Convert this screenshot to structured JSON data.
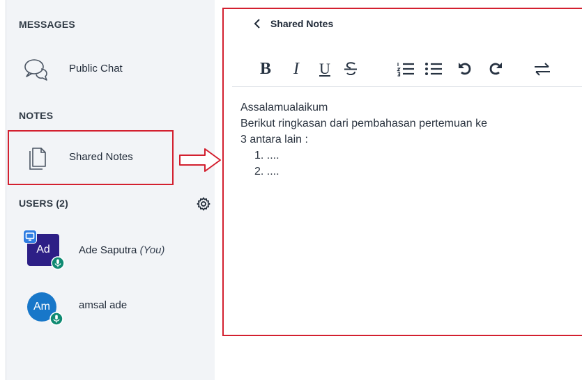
{
  "sidebar": {
    "messages_title": "MESSAGES",
    "public_chat_label": "Public Chat",
    "notes_title": "NOTES",
    "shared_notes_label": "Shared Notes",
    "users_title": "USERS (2)",
    "users": [
      {
        "initials": "Ad",
        "name": "Ade Saputra",
        "suffix": "(You)",
        "color": "#2d1f86"
      },
      {
        "initials": "Am",
        "name": "amsal ade",
        "suffix": "",
        "color": "#1877c9"
      }
    ]
  },
  "notes_panel": {
    "back_label": "Shared Notes",
    "toolbar": [
      "bold",
      "italic",
      "underline",
      "strikethrough",
      "numbered-list",
      "bullet-list",
      "undo",
      "redo",
      "import-export"
    ],
    "content": {
      "line1": "Assalamualaikum",
      "line2": "Berikut ringkasan dari pembahasan pertemuan ke",
      "line3": "3 antara lain :",
      "item1": "1. ....",
      "item2": "2. ...."
    }
  },
  "accent": "#d3202f"
}
